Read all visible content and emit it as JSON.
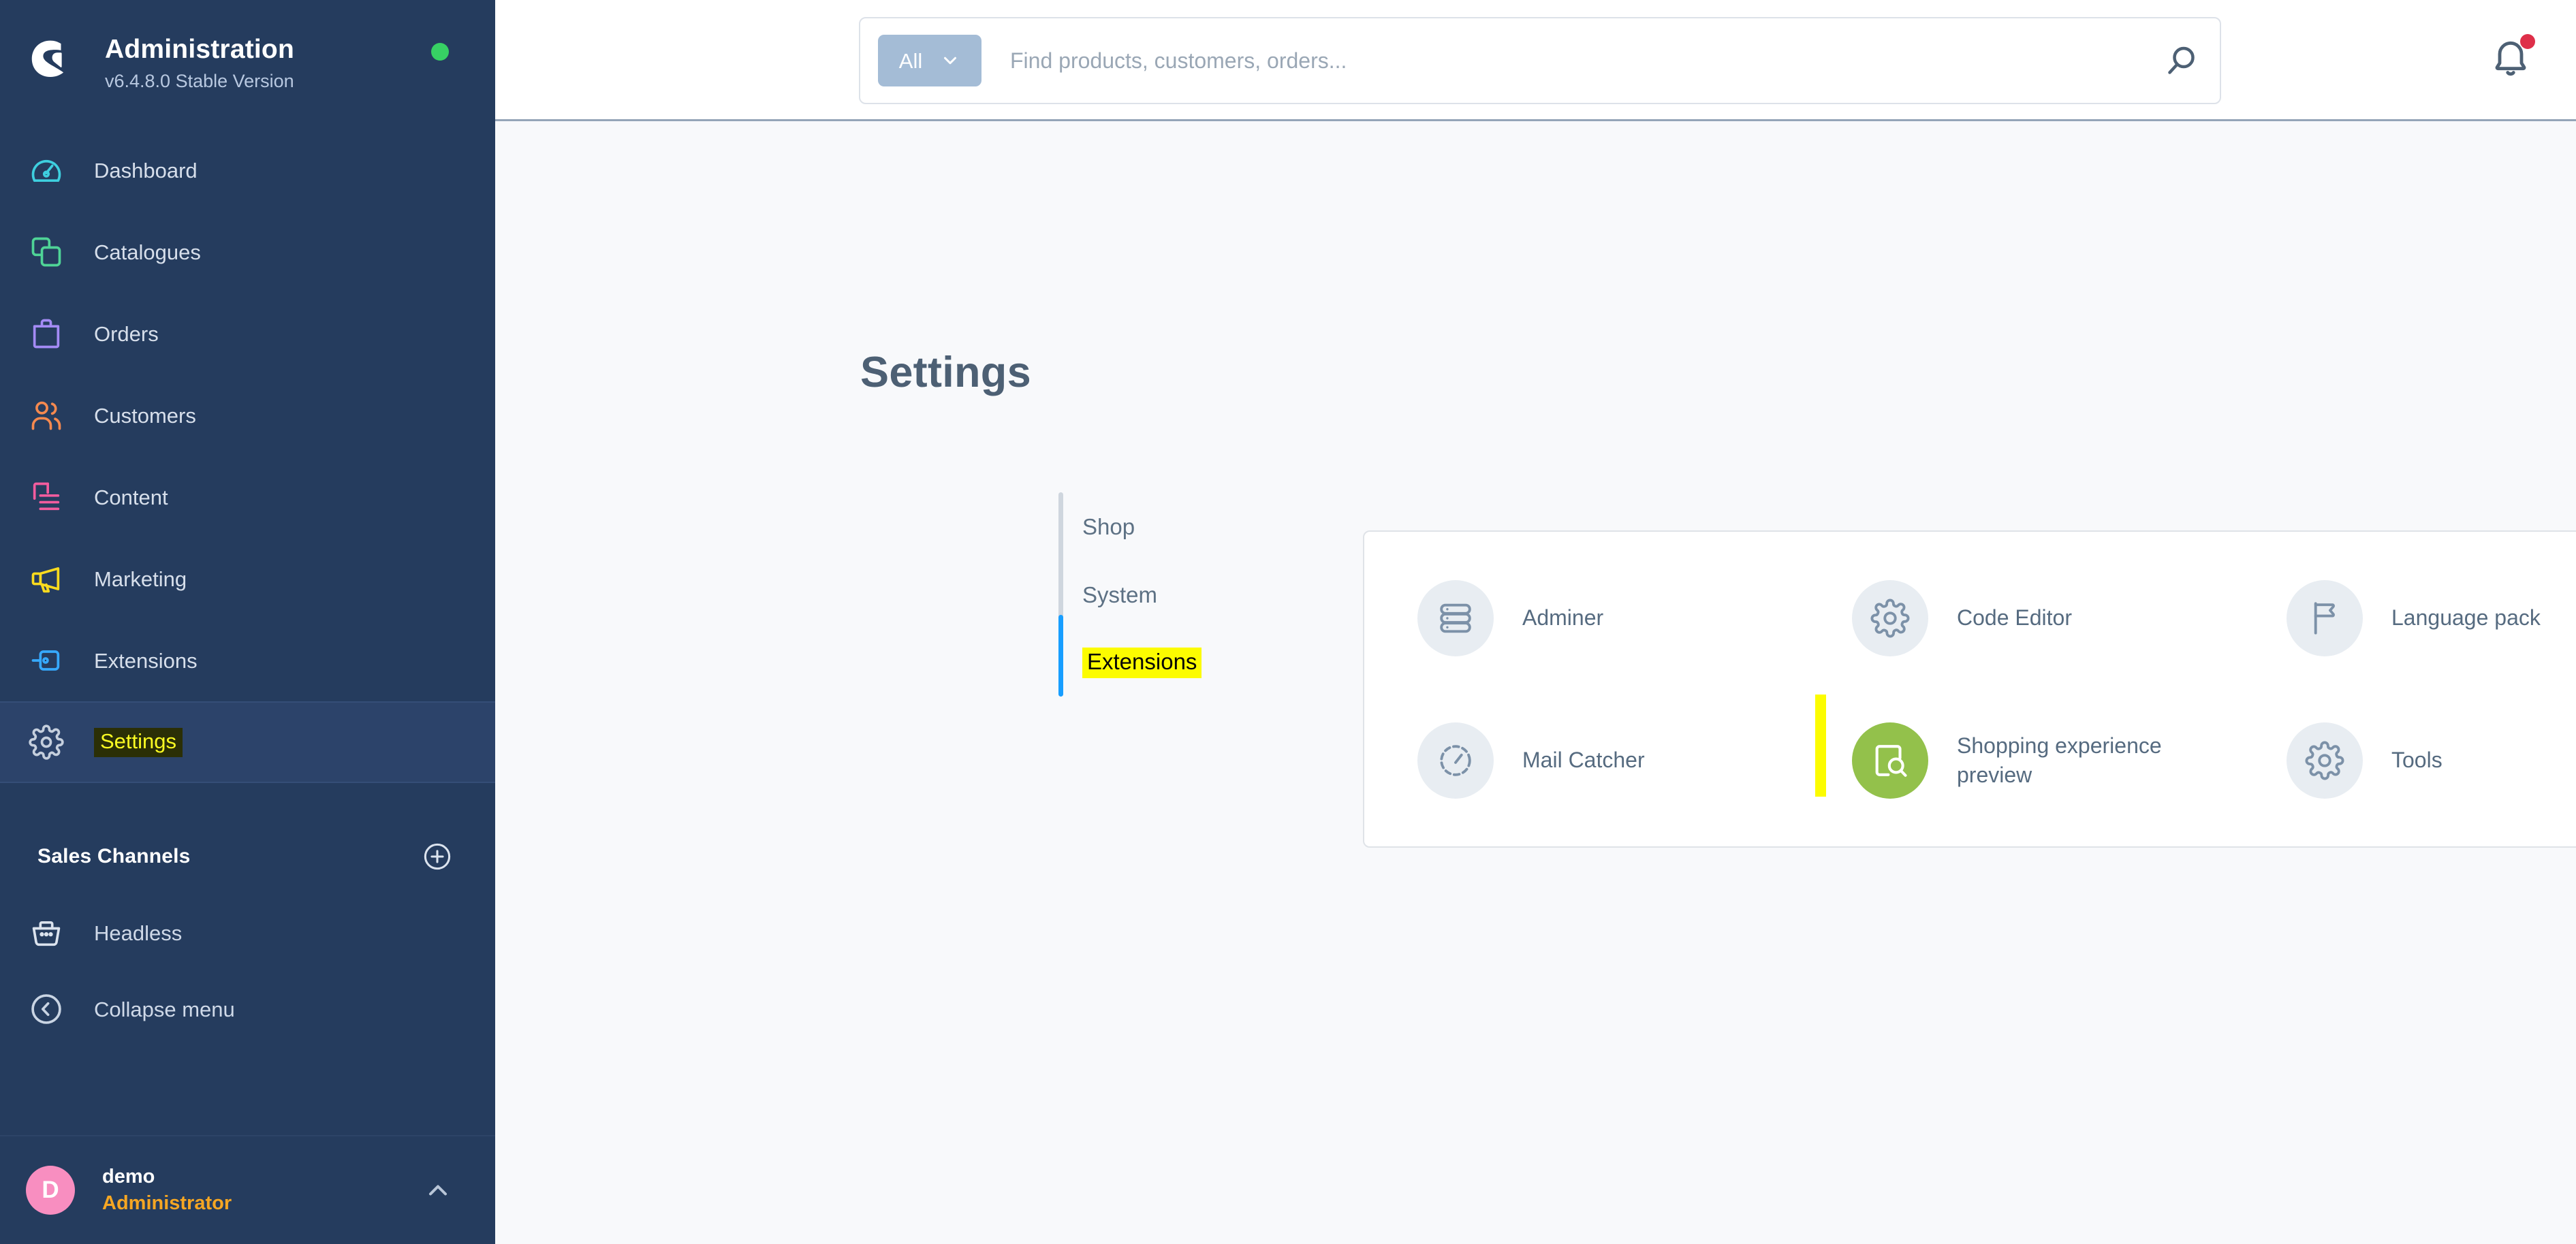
{
  "sidebar": {
    "brand": {
      "title": "Administration",
      "version": "v6.4.8.0 Stable Version",
      "status_color": "#37d064",
      "logo_icon": "shopware-logo-icon"
    },
    "nav_items": [
      {
        "label": "Dashboard",
        "icon": "gauge-icon",
        "color": "#3ecfdf",
        "active": false,
        "highlighted": false
      },
      {
        "label": "Catalogues",
        "icon": "layers-icon",
        "color": "#4fd497",
        "active": false,
        "highlighted": false
      },
      {
        "label": "Orders",
        "icon": "bag-icon",
        "color": "#a48bf5",
        "active": false,
        "highlighted": false
      },
      {
        "label": "Customers",
        "icon": "people-icon",
        "color": "#f5894f",
        "active": false,
        "highlighted": false
      },
      {
        "label": "Content",
        "icon": "content-icon",
        "color": "#f25c9e",
        "active": false,
        "highlighted": false
      },
      {
        "label": "Marketing",
        "icon": "megaphone-icon",
        "color": "#fbdb1e",
        "active": false,
        "highlighted": false
      },
      {
        "label": "Extensions",
        "icon": "plug-icon",
        "color": "#36a9ff",
        "active": false,
        "highlighted": false
      },
      {
        "label": "Settings",
        "icon": "gear-icon",
        "color": "#c5cfdd",
        "active": true,
        "highlighted": true
      }
    ],
    "sales_channels": {
      "title": "Sales Channels",
      "add_icon": "plus-circle-icon",
      "items": [
        {
          "label": "Headless",
          "icon": "basket-icon"
        }
      ]
    },
    "collapse": {
      "label": "Collapse menu",
      "icon": "chevron-left-circle-icon"
    },
    "user": {
      "avatar_initial": "D",
      "avatar_color": "#f88ec0",
      "name": "demo",
      "role": "Administrator",
      "role_color": "#f5a623",
      "caret_icon": "chevron-up-icon"
    }
  },
  "topbar": {
    "search": {
      "scope_label": "All",
      "scope_caret_icon": "chevron-down-icon",
      "placeholder": "Find products, customers, orders...",
      "value": "",
      "submit_icon": "search-icon"
    },
    "notifications": {
      "icon": "bell-icon",
      "has_unread": true,
      "dot_color": "#de2f49"
    }
  },
  "main": {
    "page_title": "Settings",
    "tabs": [
      {
        "label": "Shop",
        "active": false,
        "highlighted": false
      },
      {
        "label": "System",
        "active": false,
        "highlighted": false
      },
      {
        "label": "Extensions",
        "active": true,
        "highlighted": true
      }
    ],
    "active_tab_color": "#189eff",
    "cards": [
      {
        "label": "Adminer",
        "icon": "database-icon",
        "icon_style": "default",
        "highlighted": false
      },
      {
        "label": "Code Editor",
        "icon": "gear-icon",
        "icon_style": "default",
        "highlighted": false
      },
      {
        "label": "Language pack",
        "icon": "flag-icon",
        "icon_style": "default",
        "highlighted": false
      },
      {
        "label": "Mail Catcher",
        "icon": "gauge-icon",
        "icon_style": "default",
        "highlighted": false
      },
      {
        "label": "Shopping experience preview",
        "icon": "page-search-icon",
        "icon_style": "green",
        "highlighted": true
      },
      {
        "label": "Tools",
        "icon": "gear-icon",
        "icon_style": "default",
        "highlighted": false
      }
    ],
    "highlight_color": "#fcfc00",
    "green_icon_color": "#93c14b"
  }
}
